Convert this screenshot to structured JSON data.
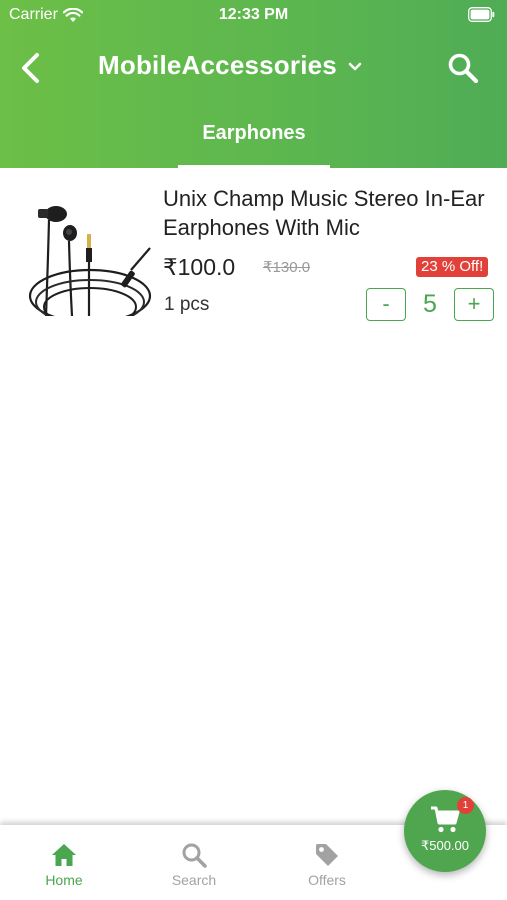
{
  "status_bar": {
    "carrier": "Carrier",
    "time": "12:33 PM"
  },
  "app_bar": {
    "title": "MobileAccessories"
  },
  "tabs": [
    {
      "label": "Earphones"
    }
  ],
  "products": [
    {
      "name": "Unix Champ Music Stereo In-Ear Earphones With Mic",
      "price": "₹100.0",
      "mrp": "₹130.0",
      "discount": "23 % Off!",
      "unit": "1 pcs",
      "qty_minus": "-",
      "quantity": "5",
      "qty_plus": "+"
    }
  ],
  "bottom_nav": [
    {
      "label": "Home",
      "icon": "home-icon"
    },
    {
      "label": "Search",
      "icon": "search-icon"
    },
    {
      "label": "Offers",
      "icon": "tag-icon"
    }
  ],
  "cart": {
    "total": "₹500.00",
    "badge": "1",
    "icon": "cart-icon"
  },
  "colors": {
    "accent": "#4aa64f",
    "header_start": "#6cbf47",
    "header_end": "#4fac55",
    "discount": "#e2413a"
  }
}
